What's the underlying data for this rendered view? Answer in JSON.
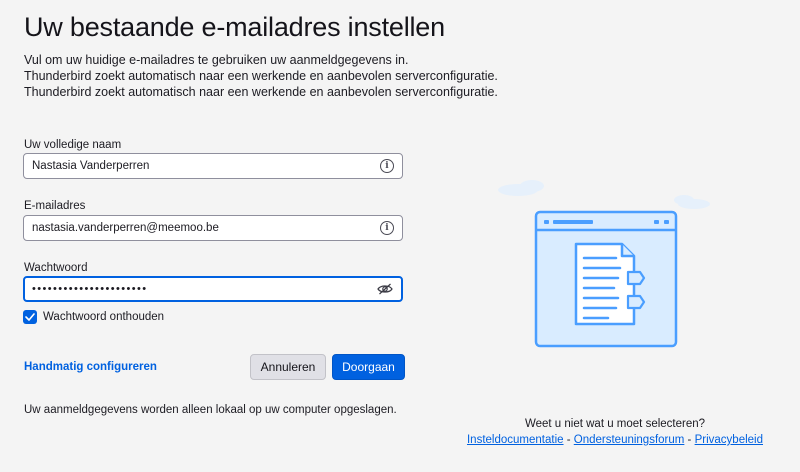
{
  "page": {
    "title": "Uw bestaande e-mailadres instellen",
    "description": [
      "Vul om uw huidige e-mailadres te gebruiken uw aanmeldgegevens in.",
      "Thunderbird zoekt automatisch naar een werkende en aanbevolen serverconfiguratie.",
      "Thunderbird zoekt automatisch naar een werkende en aanbevolen serverconfiguratie."
    ]
  },
  "form": {
    "name_label": "Uw volledige naam",
    "name_value": "Nastasia Vanderperren",
    "email_label": "E-mailadres",
    "email_value": "nastasia.vanderperren@meemoo.be",
    "password_label": "Wachtwoord",
    "password_value": "••••••••••••••••••••••",
    "remember_label": "Wachtwoord onthouden",
    "remember_checked": true
  },
  "actions": {
    "manual_config": "Handmatig configureren",
    "cancel": "Annuleren",
    "continue": "Doorgaan"
  },
  "footer": {
    "local_note": "Uw aanmeldgegevens worden alleen lokaal op uw computer opgeslagen.",
    "help_question": "Weet u niet wat u moet selecteren?",
    "link_docs": "Insteldocumentatie",
    "link_forum": "Ondersteuningsforum",
    "link_privacy": "Privacybeleid",
    "separator": " - "
  },
  "icons": {
    "info": "info-icon",
    "eye": "eye-slash-icon",
    "check": "checkmark-icon"
  },
  "colors": {
    "accent": "#0061e0",
    "background": "#f4f4f4",
    "illustration_blue": "#4a9eff",
    "illustration_light": "#d9ecff"
  }
}
